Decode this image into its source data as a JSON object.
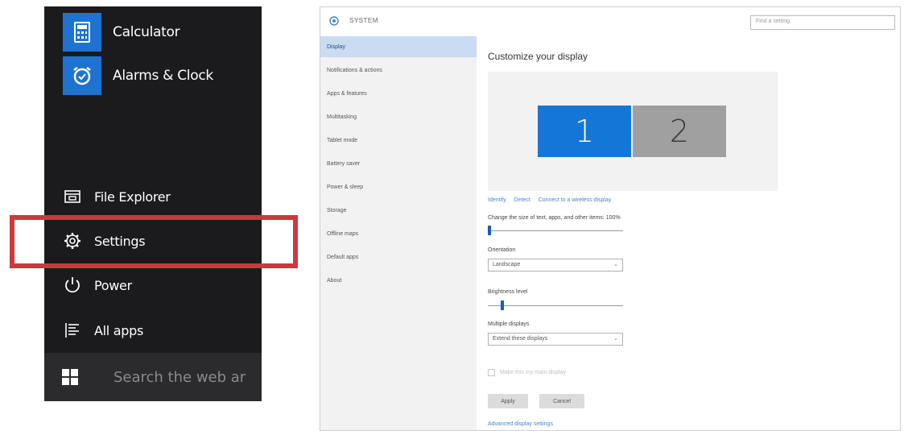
{
  "start_menu": {
    "tiles": [
      {
        "label": "Calculator",
        "icon": "calculator-icon"
      },
      {
        "label": "Alarms & Clock",
        "icon": "alarm-clock-icon"
      }
    ],
    "items": [
      {
        "label": "File Explorer",
        "icon": "file-explorer-icon"
      },
      {
        "label": "Settings",
        "icon": "gear-icon"
      },
      {
        "label": "Power",
        "icon": "power-icon"
      },
      {
        "label": "All apps",
        "icon": "list-icon"
      }
    ],
    "search_placeholder": "Search the web ar",
    "highlighted_item": "Settings",
    "highlight_color": "#c9393f",
    "tile_color": "#1e73d1"
  },
  "settings_window": {
    "title": "SYSTEM",
    "find_placeholder": "Find a setting",
    "nav_items": [
      "Display",
      "Notifications & actions",
      "Apps & features",
      "Multitasking",
      "Tablet mode",
      "Battery saver",
      "Power & sleep",
      "Storage",
      "Offline maps",
      "Default apps",
      "About"
    ],
    "active_nav": "Display",
    "content": {
      "title": "Customize your display",
      "monitors": [
        "1",
        "2"
      ],
      "links": [
        "Identify",
        "Detect",
        "Connect to a wireless display"
      ],
      "scale_label": "Change the size of text, apps, and other items: 100%",
      "scale_value_fraction": 0.0,
      "orientation_label": "Orientation",
      "orientation_value": "Landscape",
      "brightness_label": "Brightness level",
      "brightness_value_fraction": 0.1,
      "multiple_displays_label": "Multiple displays",
      "multiple_displays_value": "Extend these displays",
      "checkbox_label": "Make this my main display",
      "apply_label": "Apply",
      "cancel_label": "Cancel",
      "advanced_link": "Advanced display settings"
    },
    "accent_color": "#1476d6"
  }
}
